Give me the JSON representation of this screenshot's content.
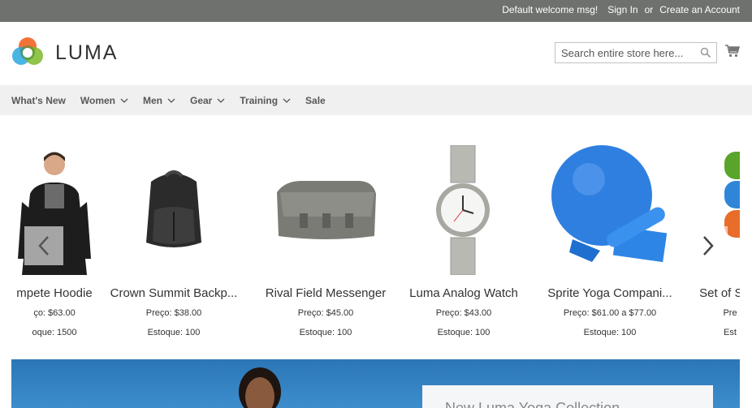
{
  "topbar": {
    "welcome": "Default welcome msg!",
    "sign_in": "Sign In",
    "or": "or",
    "create_account": "Create an Account"
  },
  "header": {
    "logo_text": "LUMA",
    "search_placeholder": "Search entire store here...",
    "icons": [
      "search-icon",
      "cart-icon"
    ]
  },
  "nav": {
    "items": [
      {
        "label": "What's New",
        "dropdown": false
      },
      {
        "label": "Women",
        "dropdown": true
      },
      {
        "label": "Men",
        "dropdown": true
      },
      {
        "label": "Gear",
        "dropdown": true
      },
      {
        "label": "Training",
        "dropdown": true
      },
      {
        "label": "Sale",
        "dropdown": false
      }
    ]
  },
  "products": [
    {
      "name": "mpete Hoodie",
      "price": "ço: $63.00",
      "stock": "oque: 1500"
    },
    {
      "name": "Crown Summit Backp...",
      "price": "Preço: $38.00",
      "stock": "Estoque: 100"
    },
    {
      "name": "Rival Field Messenger",
      "price": "Preço: $45.00",
      "stock": "Estoque: 100"
    },
    {
      "name": "Luma Analog Watch",
      "price": "Preço: $43.00",
      "stock": "Estoque: 100"
    },
    {
      "name": "Sprite Yoga Compani...",
      "price": "Preço: $61.00 a $77.00",
      "stock": "Estoque: 100"
    },
    {
      "name": "Set of Sp",
      "price": "Pre",
      "stock": "Est"
    }
  ],
  "banner": {
    "title": "New Luma Yoga Collection"
  }
}
